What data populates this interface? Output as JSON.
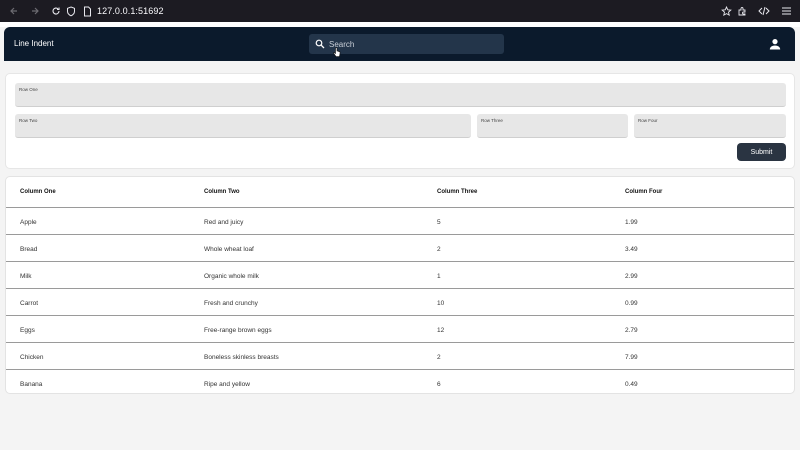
{
  "browser": {
    "url": "127.0.0.1:51692",
    "icons": [
      "back-icon",
      "forward-icon",
      "reload-icon",
      "shield-icon",
      "page-icon",
      "star-icon",
      "extensions-icon",
      "devtools-icon",
      "menu-icon"
    ]
  },
  "app": {
    "title": "Line Indent",
    "search_placeholder": "Search",
    "accent": "#0b1a2c"
  },
  "form": {
    "row_one_label": "Row One",
    "row_two_label": "Row Two",
    "row_three_label": "Row Three",
    "row_four_label": "Row Four",
    "submit_label": "Submit"
  },
  "table": {
    "headers": [
      "Column One",
      "Column Two",
      "Column Three",
      "Column Four"
    ],
    "rows": [
      [
        "Apple",
        "Red and juicy",
        "5",
        "1.99"
      ],
      [
        "Bread",
        "Whole wheat loaf",
        "2",
        "3.49"
      ],
      [
        "Milk",
        "Organic whole milk",
        "1",
        "2.99"
      ],
      [
        "Carrot",
        "Fresh and crunchy",
        "10",
        "0.99"
      ],
      [
        "Eggs",
        "Free-range brown eggs",
        "12",
        "2.79"
      ],
      [
        "Chicken",
        "Boneless skinless breasts",
        "2",
        "7.99"
      ],
      [
        "Banana",
        "Ripe and yellow",
        "6",
        "0.49"
      ]
    ]
  }
}
